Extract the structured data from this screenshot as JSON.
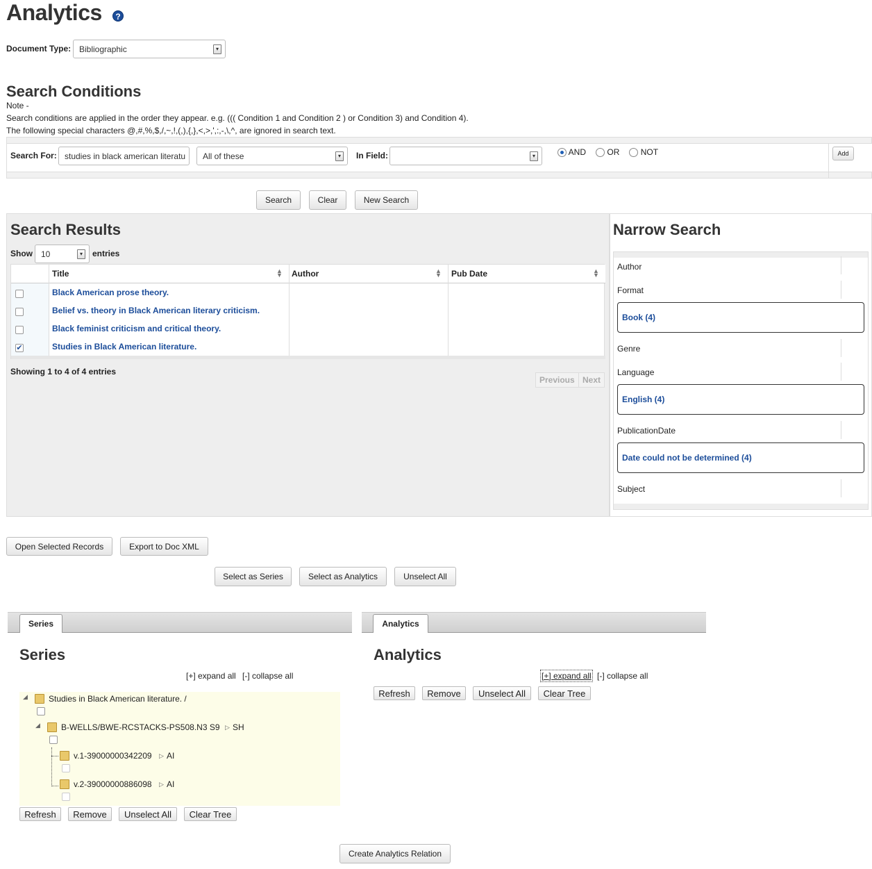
{
  "page": {
    "title": "Analytics"
  },
  "document_type": {
    "label": "Document Type:",
    "value": "Bibliographic"
  },
  "search_conditions": {
    "heading": "Search Conditions",
    "note_label": "Note -",
    "note_line1": "Search conditions are applied in the order they appear. e.g. ((( Condition 1 and Condition 2 ) or Condition 3) and Condition 4).",
    "note_line2": "The following special characters @,#,%,$,/,~,!,(,),{,},<,>,',:,-,\\,^, are ignored in search text.",
    "search_for_label": "Search For:",
    "search_for_value": "studies in black american literatu",
    "match_select": "All of these",
    "in_field_label": "In Field:",
    "in_field_value": "",
    "operators": [
      "AND",
      "OR",
      "NOT"
    ],
    "selected_operator": "AND",
    "add_label": "Add"
  },
  "search_buttons": {
    "search": "Search",
    "clear": "Clear",
    "new_search": "New Search"
  },
  "results": {
    "heading": "Search Results",
    "show_label": "Show",
    "show_value": "10",
    "entries_label": "entries",
    "columns": [
      "Title",
      "Author",
      "Pub Date"
    ],
    "rows": [
      {
        "title": "Black American prose theory.",
        "author": "",
        "pub_date": "",
        "checked": false
      },
      {
        "title": "Belief vs. theory in Black American literary criticism.",
        "author": "",
        "pub_date": "",
        "checked": false
      },
      {
        "title": "Black feminist criticism and critical theory.",
        "author": "",
        "pub_date": "",
        "checked": false
      },
      {
        "title": "Studies in Black American literature.",
        "author": "",
        "pub_date": "",
        "checked": true
      }
    ],
    "info": "Showing 1 to 4 of 4 entries",
    "previous": "Previous",
    "next": "Next"
  },
  "narrow": {
    "heading": "Narrow Search",
    "author": "Author",
    "format": "Format",
    "format_value": "Book (4)",
    "genre": "Genre",
    "language": "Language",
    "language_value": "English (4)",
    "pubdate": "PublicationDate",
    "pubdate_value": "Date could not be determined (4)",
    "subject": "Subject"
  },
  "actions": {
    "open_selected": "Open Selected Records",
    "export_xml": "Export to Doc XML",
    "select_series": "Select as Series",
    "select_analytics": "Select as Analytics",
    "unselect_all": "Unselect All"
  },
  "series": {
    "tab": "Series",
    "heading": "Series",
    "expand": "[+] expand all",
    "collapse": "[-] collapse all",
    "tree_root": "Studies in Black American literature. /",
    "tree_child": "B-WELLS/BWE-RCSTACKS-PS508.N3 S9",
    "tree_child_tag": "SH",
    "leaf1": "v.1-39000000342209",
    "leaf1_tag": "AI",
    "leaf2": "v.2-39000000886098",
    "leaf2_tag": "AI",
    "refresh": "Refresh",
    "remove": "Remove",
    "unselect_all": "Unselect All",
    "clear_tree": "Clear Tree"
  },
  "analytics": {
    "tab": "Analytics",
    "heading": "Analytics",
    "expand": "[+] expand all",
    "collapse": "[-] collapse all",
    "refresh": "Refresh",
    "remove": "Remove",
    "unselect_all": "Unselect All",
    "clear_tree": "Clear Tree"
  },
  "create_relation": "Create Analytics Relation"
}
